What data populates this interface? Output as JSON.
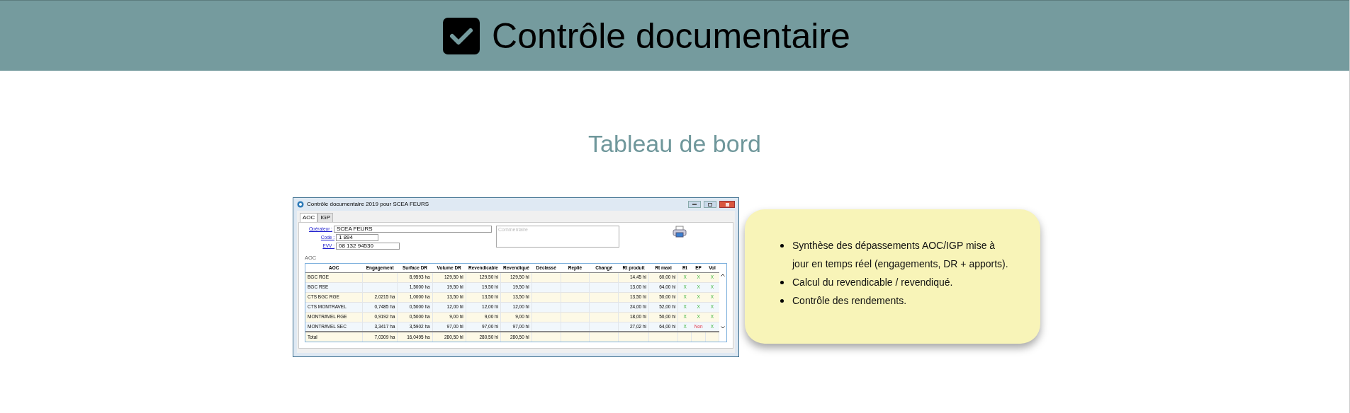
{
  "header": {
    "title": "Contrôle documentaire"
  },
  "section_title": "Tableau de bord",
  "app_window": {
    "title": "Contrôle documentaire 2019 pour SCEA FEURS",
    "tabs": [
      {
        "label": "AOC",
        "selected": true
      },
      {
        "label": "IGP",
        "selected": false
      }
    ],
    "fields": [
      {
        "label": "Opérateur :",
        "value": "SCEA FEURS",
        "kind": "wide"
      },
      {
        "label": "Code :",
        "value": "1 894",
        "kind": "short"
      },
      {
        "label": "EVV :",
        "value": "08 132 94530",
        "kind": "medium"
      }
    ],
    "comment": {
      "placeholder": "Commentaire"
    },
    "group_label": "AOC",
    "table": {
      "columns": [
        "AOC",
        "Engagement",
        "Surface DR",
        "Volume DR",
        "Revendicable",
        "Revendiqué",
        "Déclassé",
        "Replié",
        "Changé",
        "Rt produit",
        "Rt maxi",
        "Rt",
        "EP",
        "Vol"
      ],
      "rows": [
        {
          "name": "BGC RGE",
          "surface_dr": "8,9593 ha",
          "volume_dr": "129,50 hl",
          "revendicable": "129,50 hl",
          "revendique": "129,50 hl",
          "rt_produit": "14,45 hl",
          "rt_maxi": "60,00 hl",
          "checks": [
            {
              "text": "X",
              "ok": true
            },
            {
              "text": "X",
              "ok": true
            },
            {
              "text": "X",
              "ok": true
            }
          ]
        },
        {
          "name": "BGC RSE",
          "surface_dr": "1,5000 ha",
          "volume_dr": "19,50 hl",
          "revendicable": "19,50 hl",
          "revendique": "19,50 hl",
          "rt_produit": "13,00 hl",
          "rt_maxi": "64,00 hl",
          "checks": [
            {
              "text": "X",
              "ok": true
            },
            {
              "text": "X",
              "ok": true
            },
            {
              "text": "X",
              "ok": true
            }
          ]
        },
        {
          "name": "CTS BGC RGE",
          "engagement": "2,0215 ha",
          "surface_dr": "1,0000 ha",
          "volume_dr": "13,50 hl",
          "revendicable": "13,50 hl",
          "revendique": "13,50 hl",
          "rt_produit": "13,50 hl",
          "rt_maxi": "50,00 hl",
          "checks": [
            {
              "text": "X",
              "ok": true
            },
            {
              "text": "X",
              "ok": true
            },
            {
              "text": "X",
              "ok": true
            }
          ]
        },
        {
          "name": "CTS MONTRAVEL",
          "engagement": "0,7485 ha",
          "surface_dr": "0,5000 ha",
          "volume_dr": "12,00 hl",
          "revendicable": "12,00 hl",
          "revendique": "12,00 hl",
          "rt_produit": "24,00 hl",
          "rt_maxi": "52,00 hl",
          "checks": [
            {
              "text": "X",
              "ok": true
            },
            {
              "text": "X",
              "ok": true
            },
            {
              "text": "X",
              "ok": true
            }
          ]
        },
        {
          "name": "MONTRAVEL RGE",
          "engagement": "0,9192 ha",
          "surface_dr": "0,5000 ha",
          "volume_dr": "9,00 hl",
          "revendicable": "9,00 hl",
          "revendique": "9,00 hl",
          "rt_produit": "18,00 hl",
          "rt_maxi": "50,00 hl",
          "checks": [
            {
              "text": "X",
              "ok": true
            },
            {
              "text": "X",
              "ok": true
            },
            {
              "text": "X",
              "ok": true
            }
          ]
        },
        {
          "name": "MONTRAVEL SEC",
          "engagement": "3,3417 ha",
          "surface_dr": "3,5902 ha",
          "volume_dr": "97,00 hl",
          "revendicable": "97,00 hl",
          "revendique": "97,00 hl",
          "rt_produit": "27,02 hl",
          "rt_maxi": "64,00 hl",
          "checks": [
            {
              "text": "X",
              "ok": true
            },
            {
              "text": "Non",
              "ok": false
            },
            {
              "text": "X",
              "ok": true
            }
          ]
        }
      ],
      "total": {
        "name": "Total",
        "engagement": "7,0309 ha",
        "surface_dr": "16,0495 ha",
        "volume_dr": "280,50 hl",
        "revendicable": "280,50 hl",
        "revendique": "280,50 hl"
      }
    }
  },
  "note": {
    "items": [
      "Synthèse des dépassements AOC/IGP mise à jour en temps réel (engagements, DR + apports).",
      "Calcul du revendicable / revendiqué.",
      "Contrôle des rendements."
    ]
  }
}
